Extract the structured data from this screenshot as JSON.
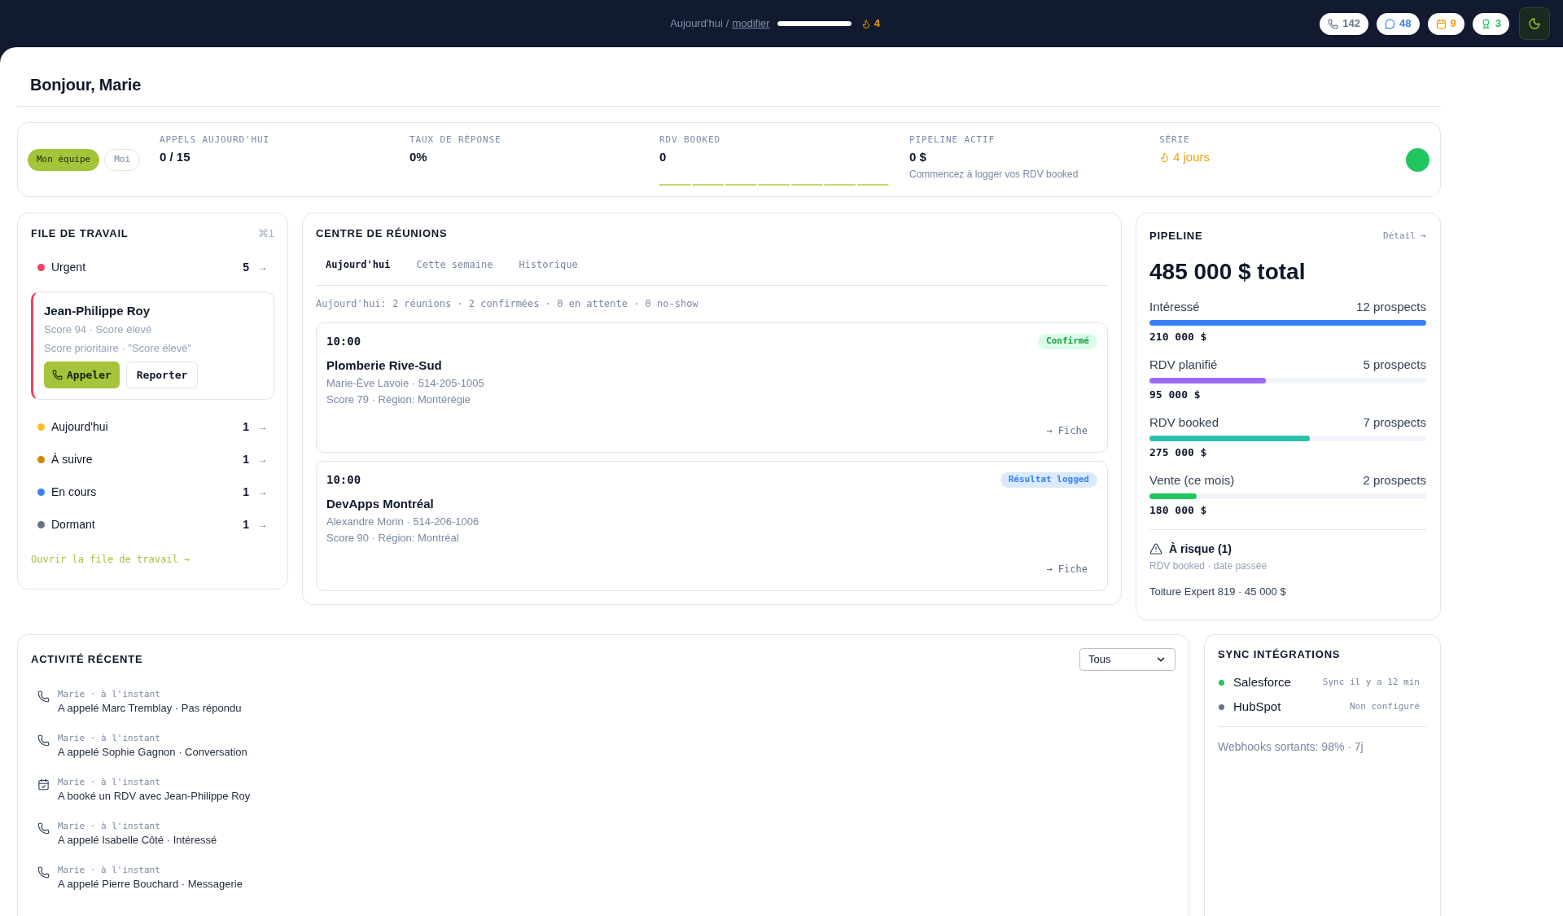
{
  "top_bar": {
    "goal": {
      "label": "Aujourd'hui",
      "separator": "/",
      "link": "modifier",
      "level": 1
    },
    "streak": "4",
    "counters": [
      {
        "kind": "calls",
        "value": "142",
        "color": "#64748b"
      },
      {
        "kind": "messages",
        "value": "48",
        "color": "#3b82f6"
      },
      {
        "kind": "meetings",
        "value": "9",
        "color": "#f59e0b"
      },
      {
        "kind": "awards",
        "value": "3",
        "color": "#22c55e"
      }
    ]
  },
  "greeting": "Bonjour, Marie",
  "stats": {
    "scope": [
      {
        "label": "Mon équipe",
        "selected": true
      },
      {
        "label": "Moi",
        "selected": false
      }
    ],
    "items": [
      {
        "kind": "value",
        "label": "APPELS AUJOURD'HUI",
        "value": "0 / 15"
      },
      {
        "kind": "value",
        "label": "TAUX DE RÉPONSE",
        "value": "0%"
      },
      {
        "kind": "sparkline",
        "label": "RDV BOOKED",
        "value": "0"
      },
      {
        "kind": "note",
        "label": "PIPELINE ACTIF",
        "value": "0 $",
        "note": "Commencez à logger vos RDV booked"
      },
      {
        "kind": "streak",
        "label": "SÉRIE",
        "value": "4 jours"
      }
    ],
    "online": true
  },
  "work_queue": {
    "title": "FILE DE TRAVAIL",
    "shortcut": "⌘1",
    "groups": [
      {
        "label": "Urgent",
        "count": "5",
        "arrow": "→",
        "color": "#f43f5e",
        "lead": {
          "name": "Jean-Philippe Roy",
          "details": [
            "Score 94 · Score élevé",
            "Score prioritaire · \"Score élevé\""
          ],
          "actions": [
            {
              "kind": "primary",
              "label": "Appeler"
            },
            {
              "kind": "secondary",
              "label": "Reporter"
            }
          ]
        }
      },
      {
        "label": "Aujourd'hui",
        "count": "1",
        "arrow": "→",
        "color": "#fbbf24"
      },
      {
        "label": "À suivre",
        "count": "1",
        "arrow": "→",
        "color": "#ca8a04"
      },
      {
        "label": "En cours",
        "count": "1",
        "arrow": "→",
        "color": "#3b82f6"
      },
      {
        "label": "Dormant",
        "count": "1",
        "arrow": "→",
        "color": "#64748b"
      }
    ],
    "link": "Ouvrir la file de travail →"
  },
  "meetings": {
    "title": "CENTRE DE RÉUNIONS",
    "tabs": [
      {
        "label": "Aujourd'hui",
        "selected": true
      },
      {
        "label": "Cette semaine",
        "selected": false
      },
      {
        "label": "Historique",
        "selected": false
      }
    ],
    "summary": "Aujourd'hui: 2 réunions · 2 confirmées · 0 en attente · 0 no-show",
    "items": [
      {
        "time": "10:00",
        "status": {
          "kind": "confirmed",
          "label": "Confirmé"
        },
        "company": "Plomberie Rive-Sud",
        "contact": "Marie-Ève Lavoie · 514-205-1005",
        "details": "Score 79 · Région: Montérégie",
        "link": "→ Fiche"
      },
      {
        "time": "10:00",
        "status": {
          "kind": "logged",
          "label": "Résultat logged"
        },
        "company": "DevApps Montréal",
        "contact": "Alexandre Morin · 514-206-1006",
        "details": "Score 90 · Région: Montréal",
        "link": "→ Fiche"
      }
    ]
  },
  "pipeline": {
    "title": "PIPELINE",
    "link": "Détail →",
    "total": "485 000 $ total",
    "stages": [
      {
        "label": "Intéressé",
        "count": "12 prospects",
        "level": 1,
        "color": "#3b82f6",
        "amount": "210 000 $"
      },
      {
        "label": "RDV planifié",
        "count": "5 prospects",
        "level": 0.42,
        "color": "#9b6bfa",
        "amount": "95 000 $"
      },
      {
        "label": "RDV booked",
        "count": "7 prospects",
        "level": 0.58,
        "color": "#2bbfae",
        "amount": "275 000 $"
      },
      {
        "label": "Vente (ce mois)",
        "count": "2 prospects",
        "level": 0.17,
        "color": "#22c55e",
        "amount": "180 000 $"
      }
    ],
    "risk": {
      "title": "À risque (1)",
      "subtitle": "RDV booked · date passée",
      "item": "Toiture Expert 819 · 45 000 $"
    }
  },
  "activity": {
    "title": "ACTIVITÉ RÉCENTE",
    "filter": {
      "value": "Tous"
    },
    "items": [
      {
        "kind": "call",
        "meta": "Marie · à l'instant",
        "text": "A appelé Marc Tremblay · Pas répondu"
      },
      {
        "kind": "call",
        "meta": "Marie · à l'instant",
        "text": "A appelé Sophie Gagnon · Conversation"
      },
      {
        "kind": "booking",
        "meta": "Marie · à l'instant",
        "text": "A booké un RDV avec Jean-Philippe Roy"
      },
      {
        "kind": "call",
        "meta": "Marie · à l'instant",
        "text": "A appelé Isabelle Côté · Intéressé"
      },
      {
        "kind": "call",
        "meta": "Marie · à l'instant",
        "text": "A appelé Pierre Bouchard · Messagerie"
      }
    ]
  },
  "sync": {
    "title": "SYNC INTÉGRATIONS",
    "integrations": [
      {
        "name": "Salesforce",
        "status": "Sync il y a 12 min",
        "color": "#22c55e"
      },
      {
        "name": "HubSpot",
        "status": "Non configuré",
        "color": "#64748b"
      }
    ],
    "webhooks": "Webhooks sortants: 98% · 7j"
  }
}
